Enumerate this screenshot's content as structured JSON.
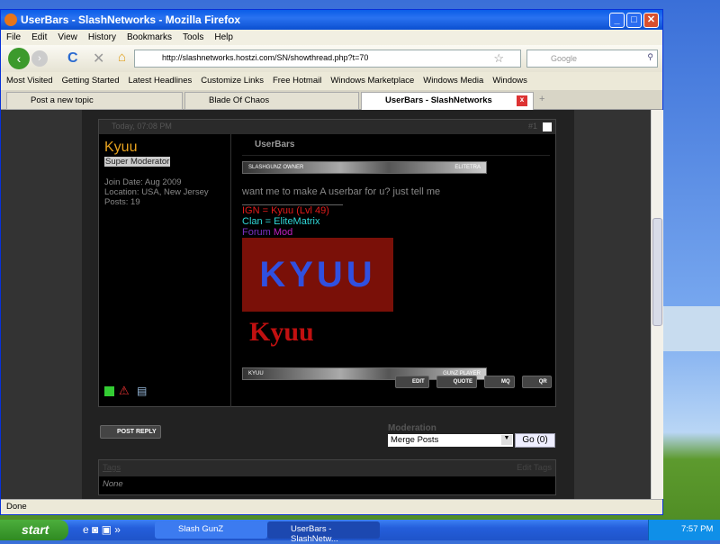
{
  "window": {
    "title": "UserBars - SlashNetworks - Mozilla Firefox",
    "controls": [
      "_",
      "□",
      "✕"
    ]
  },
  "menu": [
    "File",
    "Edit",
    "View",
    "History",
    "Bookmarks",
    "Tools",
    "Help"
  ],
  "nav": {
    "url": "http://slashnetworks.hostzi.com/SN/showthread.php?t=70",
    "search_placeholder": "Google"
  },
  "bookmarks": [
    "Most Visited",
    "Getting Started",
    "Latest Headlines",
    "Customize Links",
    "Free Hotmail",
    "Windows Marketplace",
    "Windows Media",
    "Windows"
  ],
  "tabs": [
    {
      "label": "Post a new topic"
    },
    {
      "label": "Blade Of Chaos"
    },
    {
      "label": "UserBars - SlashNetworks",
      "active": true
    }
  ],
  "post": {
    "date": "Today, 07:08 PM",
    "number": "#1",
    "user": {
      "name": "Kyuu",
      "rank": "Super Moderator",
      "join": "Join Date: Aug 2009",
      "location": "Location: USA, New Jersey",
      "posts": "Posts: 19"
    },
    "title": "UserBars",
    "userbar1": {
      "left": "SLASHGUNZ OWNER",
      "right": "ELITETRA"
    },
    "message": "want me to make A userbar for u? just tell me",
    "sig": {
      "ign": "IGN = Kyuu (Lvl 49)",
      "clan": "Clan = EliteMatrix",
      "forum": "Forum",
      "mod": "Mod"
    },
    "kyuu_banner": "KYUU",
    "kyuu_logo": "Kyuu",
    "userbar2": {
      "left": "KYUU",
      "right": "GUNZ PLAYER"
    },
    "buttons": {
      "edit": "EDIT",
      "quote": "QUOTE",
      "mq": "MQ",
      "qr": "QR"
    }
  },
  "post_reply": "POST REPLY",
  "moderation": {
    "label": "Moderation",
    "selected": "Merge Posts",
    "go": "Go (0)"
  },
  "tags": {
    "label": "Tags",
    "edit": "Edit Tags",
    "value": "None"
  },
  "status": "Done",
  "taskbar": {
    "start": "start",
    "tasks": [
      "Slash GunZ",
      "UserBars - SlashNetw..."
    ],
    "clock": "7:57 PM"
  },
  "colors": {
    "username": "#e7a21f",
    "ign": "#e21b1b",
    "clan": "#2fd6d6",
    "mod": "#c020c0"
  }
}
